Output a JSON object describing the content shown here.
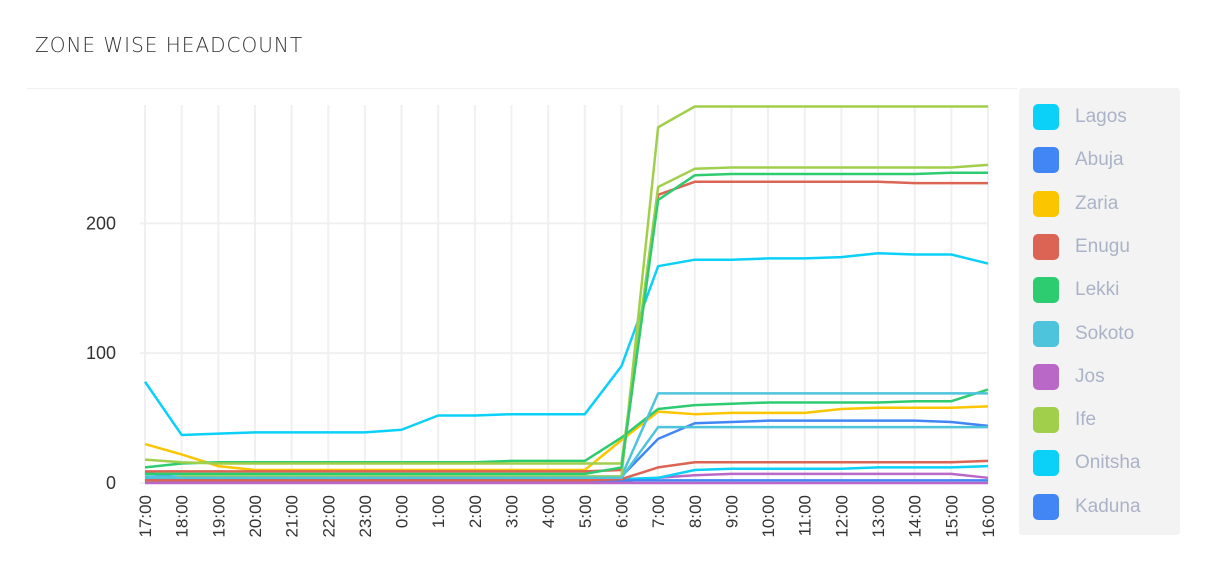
{
  "title": "ZONE WISE HEADCOUNT",
  "chart_data": {
    "type": "line",
    "title": "ZONE WISE HEADCOUNT",
    "xlabel": "",
    "ylabel": "",
    "ylim": [
      0,
      295
    ],
    "yticks": [
      0,
      100,
      200
    ],
    "grid": true,
    "legend_position": "right",
    "categories": [
      "17:00",
      "18:00",
      "19:00",
      "20:00",
      "21:00",
      "22:00",
      "23:00",
      "0:00",
      "1:00",
      "2:00",
      "3:00",
      "4:00",
      "5:00",
      "6:00",
      "7:00",
      "8:00",
      "9:00",
      "10:00",
      "11:00",
      "12:00",
      "13:00",
      "14:00",
      "15:00",
      "16:00"
    ],
    "series": [
      {
        "name": "Lagos",
        "color": "#0bd0f7",
        "values": [
          78,
          37,
          38,
          39,
          39,
          39,
          39,
          41,
          52,
          52,
          53,
          53,
          53,
          90,
          167,
          172,
          172,
          173,
          173,
          174,
          177,
          176,
          176,
          169
        ]
      },
      {
        "name": "Abuja",
        "color": "#4285f4",
        "values": [
          8,
          4,
          4,
          4,
          4,
          4,
          4,
          4,
          4,
          4,
          4,
          4,
          4,
          5,
          34,
          46,
          47,
          48,
          48,
          48,
          48,
          48,
          47,
          44
        ]
      },
      {
        "name": "Zaria",
        "color": "#fbc500",
        "values": [
          30,
          22,
          13,
          10,
          10,
          10,
          10,
          10,
          10,
          10,
          10,
          10,
          10,
          33,
          55,
          53,
          54,
          54,
          54,
          57,
          58,
          58,
          58,
          59
        ]
      },
      {
        "name": "Enugu",
        "color": "#db6454",
        "values": [
          9,
          9,
          9,
          9,
          9,
          9,
          9,
          9,
          9,
          9,
          9,
          9,
          9,
          10,
          222,
          232,
          232,
          232,
          232,
          232,
          232,
          231,
          231,
          231
        ]
      },
      {
        "name": "Lekki",
        "color": "#2ecc71",
        "values": [
          12,
          15,
          16,
          16,
          16,
          16,
          16,
          16,
          16,
          16,
          17,
          17,
          17,
          35,
          57,
          60,
          61,
          62,
          62,
          62,
          62,
          63,
          63,
          72
        ]
      },
      {
        "name": "Sokoto",
        "color": "#4dc3dc",
        "values": [
          5,
          5,
          5,
          5,
          5,
          5,
          5,
          5,
          5,
          5,
          5,
          5,
          5,
          5,
          69,
          69,
          69,
          69,
          69,
          69,
          69,
          69,
          69,
          69
        ]
      },
      {
        "name": "Jos",
        "color": "#ba68c8",
        "values": [
          1,
          1,
          1,
          1,
          1,
          1,
          1,
          1,
          1,
          1,
          1,
          1,
          1,
          1,
          4,
          6,
          7,
          7,
          7,
          7,
          7,
          7,
          7,
          4
        ]
      },
      {
        "name": "Ife",
        "color": "#a1cf4c",
        "values": [
          0,
          5,
          5,
          5,
          5,
          5,
          5,
          5,
          5,
          5,
          5,
          5,
          5,
          5,
          274,
          290,
          290,
          290,
          290,
          290,
          290,
          290,
          290,
          290
        ]
      },
      {
        "name": "Onitsha",
        "color": "#0bd0f7",
        "values": [
          3,
          3,
          3,
          3,
          3,
          3,
          3,
          3,
          3,
          3,
          3,
          3,
          3,
          3,
          4,
          10,
          11,
          11,
          11,
          11,
          12,
          12,
          12,
          13
        ]
      },
      {
        "name": "Kaduna",
        "color": "#4285f4",
        "values": [
          2,
          2,
          2,
          2,
          2,
          2,
          2,
          2,
          2,
          2,
          2,
          2,
          2,
          2,
          2,
          2,
          2,
          2,
          2,
          2,
          2,
          2,
          2,
          2
        ]
      },
      {
        "color": "#a1cf4c",
        "values": [
          18,
          16,
          15,
          15,
          15,
          15,
          15,
          15,
          15,
          15,
          15,
          15,
          15,
          15,
          228,
          242,
          243,
          243,
          243,
          243,
          243,
          243,
          243,
          245
        ]
      },
      {
        "color": "#2ecc71",
        "values": [
          7,
          7,
          7,
          7,
          7,
          7,
          7,
          7,
          7,
          7,
          7,
          7,
          7,
          12,
          218,
          237,
          238,
          238,
          238,
          238,
          238,
          238,
          239,
          239
        ]
      },
      {
        "color": "#db6454",
        "values": [
          2,
          2,
          2,
          2,
          2,
          2,
          2,
          2,
          2,
          2,
          2,
          2,
          2,
          3,
          12,
          16,
          16,
          16,
          16,
          16,
          16,
          16,
          16,
          17
        ]
      },
      {
        "color": "#4dc3dc",
        "values": [
          4,
          4,
          4,
          4,
          4,
          4,
          4,
          4,
          4,
          4,
          4,
          4,
          4,
          4,
          43,
          43,
          43,
          43,
          43,
          43,
          43,
          43,
          43,
          43
        ]
      },
      {
        "color": "#ba68c8",
        "values": [
          0,
          0,
          0,
          0,
          0,
          0,
          0,
          0,
          0,
          0,
          0,
          0,
          0,
          0,
          0,
          0,
          0,
          0,
          0,
          0,
          0,
          0,
          0,
          0
        ]
      }
    ]
  }
}
